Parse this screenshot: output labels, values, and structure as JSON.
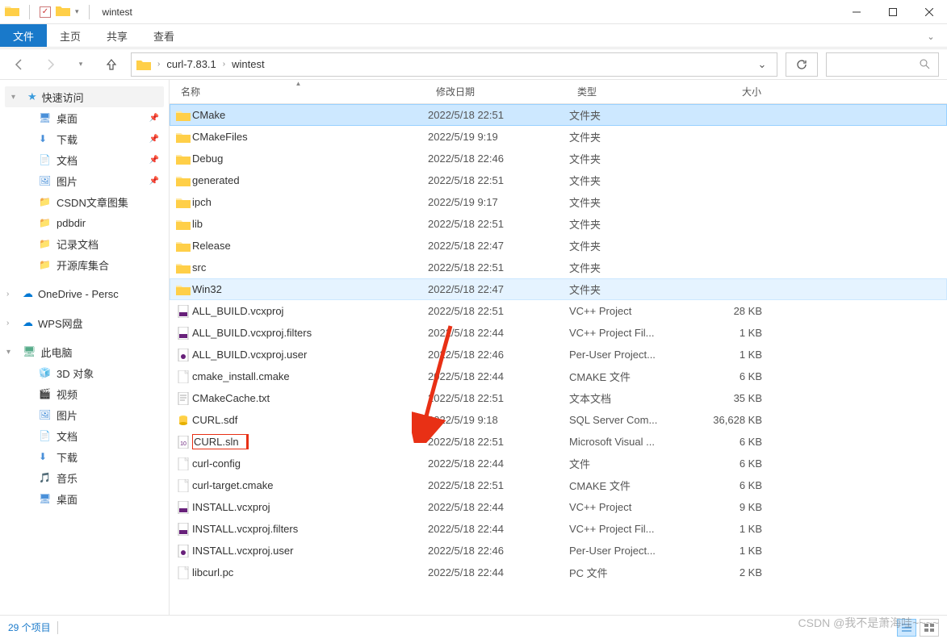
{
  "window": {
    "title": "wintest"
  },
  "tabs": {
    "file": "文件",
    "home": "主页",
    "share": "共享",
    "view": "查看"
  },
  "breadcrumbs": [
    "curl-7.83.1",
    "wintest"
  ],
  "columns": {
    "name": "名称",
    "date": "修改日期",
    "type": "类型",
    "size": "大小"
  },
  "sidebar": {
    "quickAccess": "快速访问",
    "quickItems": [
      {
        "label": "桌面",
        "pinned": true,
        "icon": "desktop"
      },
      {
        "label": "下载",
        "pinned": true,
        "icon": "downloads"
      },
      {
        "label": "文档",
        "pinned": true,
        "icon": "documents"
      },
      {
        "label": "图片",
        "pinned": true,
        "icon": "pictures"
      },
      {
        "label": "CSDN文章图集",
        "pinned": false,
        "icon": "folder"
      },
      {
        "label": "pdbdir",
        "pinned": false,
        "icon": "folder"
      },
      {
        "label": "记录文档",
        "pinned": false,
        "icon": "folder"
      },
      {
        "label": "开源库集合",
        "pinned": false,
        "icon": "folder"
      }
    ],
    "oneDrive": "OneDrive - Persc",
    "wps": "WPS网盘",
    "thisPC": "此电脑",
    "pcItems": [
      {
        "label": "3D 对象",
        "icon": "3d"
      },
      {
        "label": "视频",
        "icon": "video"
      },
      {
        "label": "图片",
        "icon": "pictures"
      },
      {
        "label": "文档",
        "icon": "documents"
      },
      {
        "label": "下载",
        "icon": "downloads"
      },
      {
        "label": "音乐",
        "icon": "music"
      },
      {
        "label": "桌面",
        "icon": "desktop"
      }
    ]
  },
  "files": [
    {
      "name": "CMake",
      "date": "2022/5/18 22:51",
      "type": "文件夹",
      "size": "",
      "kind": "folder",
      "selected": true
    },
    {
      "name": "CMakeFiles",
      "date": "2022/5/19 9:19",
      "type": "文件夹",
      "size": "",
      "kind": "folder"
    },
    {
      "name": "Debug",
      "date": "2022/5/18 22:46",
      "type": "文件夹",
      "size": "",
      "kind": "folder"
    },
    {
      "name": "generated",
      "date": "2022/5/18 22:51",
      "type": "文件夹",
      "size": "",
      "kind": "folder"
    },
    {
      "name": "ipch",
      "date": "2022/5/19 9:17",
      "type": "文件夹",
      "size": "",
      "kind": "folder"
    },
    {
      "name": "lib",
      "date": "2022/5/18 22:51",
      "type": "文件夹",
      "size": "",
      "kind": "folder"
    },
    {
      "name": "Release",
      "date": "2022/5/18 22:47",
      "type": "文件夹",
      "size": "",
      "kind": "folder"
    },
    {
      "name": "src",
      "date": "2022/5/18 22:51",
      "type": "文件夹",
      "size": "",
      "kind": "folder"
    },
    {
      "name": "Win32",
      "date": "2022/5/18 22:47",
      "type": "文件夹",
      "size": "",
      "kind": "folder",
      "hoversel": true
    },
    {
      "name": "ALL_BUILD.vcxproj",
      "date": "2022/5/18 22:51",
      "type": "VC++ Project",
      "size": "28 KB",
      "kind": "vcxproj"
    },
    {
      "name": "ALL_BUILD.vcxproj.filters",
      "date": "2022/5/18 22:44",
      "type": "VC++ Project Fil...",
      "size": "1 KB",
      "kind": "vcxproj"
    },
    {
      "name": "ALL_BUILD.vcxproj.user",
      "date": "2022/5/18 22:46",
      "type": "Per-User Project...",
      "size": "1 KB",
      "kind": "user"
    },
    {
      "name": "cmake_install.cmake",
      "date": "2022/5/18 22:44",
      "type": "CMAKE 文件",
      "size": "6 KB",
      "kind": "file"
    },
    {
      "name": "CMakeCache.txt",
      "date": "2022/5/18 22:51",
      "type": "文本文档",
      "size": "35 KB",
      "kind": "txt"
    },
    {
      "name": "CURL.sdf",
      "date": "2022/5/19 9:18",
      "type": "SQL Server Com...",
      "size": "36,628 KB",
      "kind": "sdf"
    },
    {
      "name": "CURL.sln",
      "date": "2022/5/18 22:51",
      "type": "Microsoft Visual ...",
      "size": "6 KB",
      "kind": "sln",
      "highlight": true
    },
    {
      "name": "curl-config",
      "date": "2022/5/18 22:44",
      "type": "文件",
      "size": "6 KB",
      "kind": "file"
    },
    {
      "name": "curl-target.cmake",
      "date": "2022/5/18 22:51",
      "type": "CMAKE 文件",
      "size": "6 KB",
      "kind": "file"
    },
    {
      "name": "INSTALL.vcxproj",
      "date": "2022/5/18 22:44",
      "type": "VC++ Project",
      "size": "9 KB",
      "kind": "vcxproj"
    },
    {
      "name": "INSTALL.vcxproj.filters",
      "date": "2022/5/18 22:44",
      "type": "VC++ Project Fil...",
      "size": "1 KB",
      "kind": "vcxproj"
    },
    {
      "name": "INSTALL.vcxproj.user",
      "date": "2022/5/18 22:46",
      "type": "Per-User Project...",
      "size": "1 KB",
      "kind": "user"
    },
    {
      "name": "libcurl.pc",
      "date": "2022/5/18 22:44",
      "type": "PC 文件",
      "size": "2 KB",
      "kind": "file"
    }
  ],
  "status": {
    "count": "29 个项目"
  },
  "watermark": "CSDN @我不是萧海哇~~~~"
}
